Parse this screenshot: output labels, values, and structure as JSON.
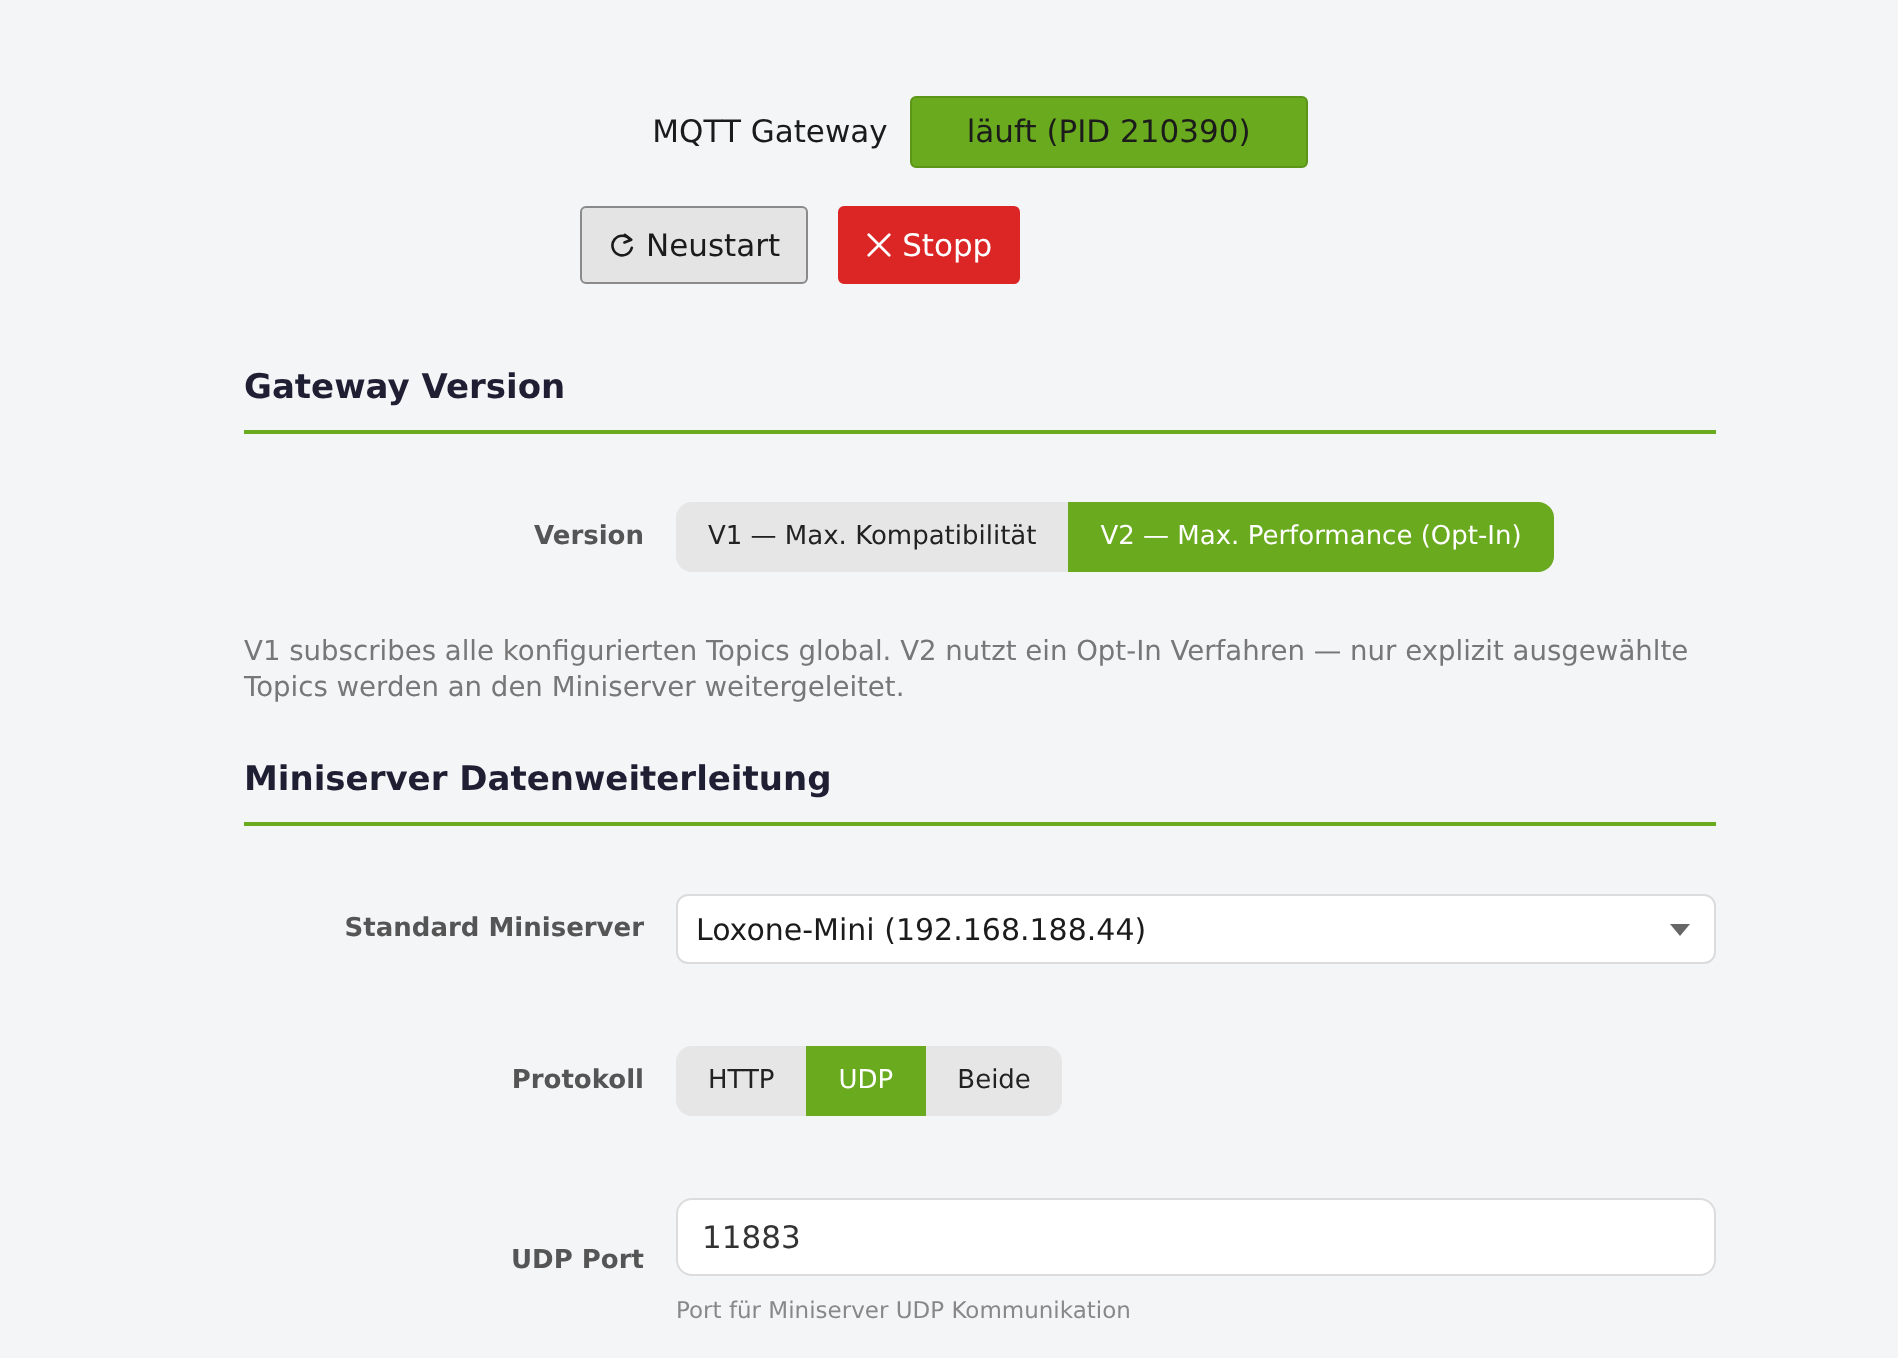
{
  "gateway": {
    "label": "MQTT Gateway",
    "status": "läuft (PID 210390)",
    "running": true
  },
  "actions": [
    {
      "kind": "restart",
      "label": "Neustart"
    },
    {
      "kind": "stop",
      "label": "Stopp"
    }
  ],
  "sections": [
    {
      "title": "Gateway Version",
      "fields": [
        {
          "kind": "segmented",
          "label": "Version",
          "options": [
            {
              "label": "V1 — Max. Kompatibilität",
              "selected": false
            },
            {
              "label": "V2 — Max. Performance (Opt-In)",
              "selected": true
            }
          ]
        }
      ],
      "note": "V1 subscribes alle konfigurierten Topics global. V2 nutzt ein Opt-In Verfahren — nur explizit ausgewählte Topics werden an den Miniserver weitergeleitet."
    },
    {
      "title": "Miniserver Datenweiterleitung",
      "fields": [
        {
          "kind": "select",
          "label": "Standard Miniserver",
          "value": "Loxone-Mini (192.168.188.44)"
        },
        {
          "kind": "segmented",
          "label": "Protokoll",
          "options": [
            {
              "label": "HTTP",
              "selected": false
            },
            {
              "label": "UDP",
              "selected": true
            },
            {
              "label": "Beide",
              "selected": false
            }
          ]
        },
        {
          "kind": "text",
          "label": "UDP Port",
          "value": "11883",
          "help": "Port für Miniserver UDP Kommunikation"
        }
      ]
    }
  ]
}
